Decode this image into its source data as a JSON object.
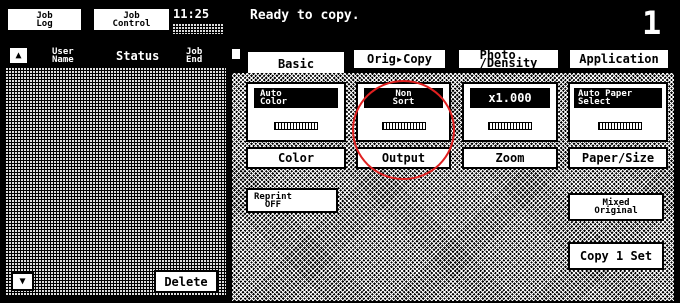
{
  "header": {
    "job_log": "Job\nLog",
    "job_control": "Job\nControl",
    "time": "11:25",
    "status_message": "Ready to copy.",
    "copy_count": "1"
  },
  "job_list": {
    "col_user": "User\nName",
    "col_status": "Status",
    "col_jobend": "Job\nEnd",
    "delete_label": "Delete"
  },
  "tabs": [
    {
      "label": "Basic"
    },
    {
      "label": "Orig▸Copy"
    },
    {
      "label": "Photo\n/Density"
    },
    {
      "label": "Application"
    }
  ],
  "functions": [
    {
      "value": "Auto\nColor",
      "name": "Color"
    },
    {
      "value": "Non\nSort",
      "name": "Output"
    },
    {
      "value": "x1.000",
      "name": "Zoom"
    },
    {
      "value": "Auto Paper\nSelect",
      "name": "Paper/Size"
    }
  ],
  "options": {
    "reprint": "Reprint\nOFF",
    "mixed_original": "Mixed\nOriginal",
    "copy_set": "Copy 1 Set"
  },
  "annotation": {
    "color": "#e02020"
  }
}
